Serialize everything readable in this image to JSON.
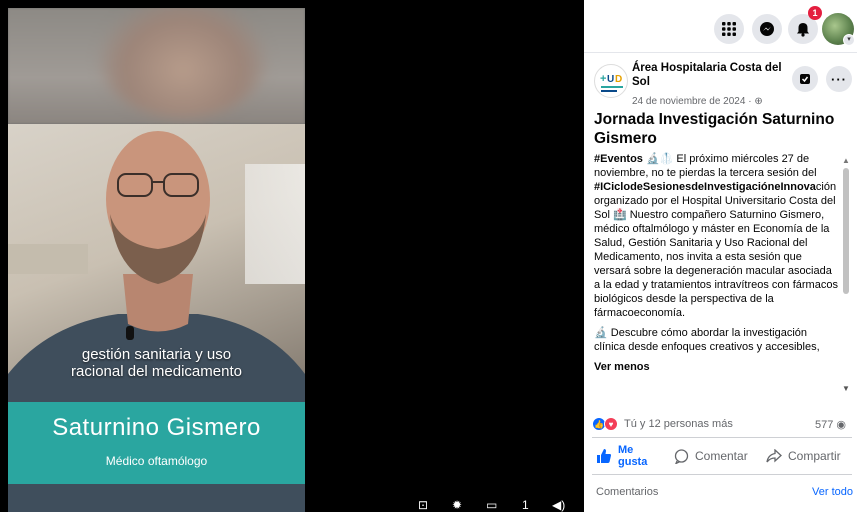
{
  "video": {
    "caption_line1": "gestión sanitaria y uso",
    "caption_line2": "racional del medicamento",
    "banner_name": "Saturnino Gismero",
    "banner_role": "Médico oftamólogo",
    "controls": {
      "duration_short": "1"
    }
  },
  "topbar": {
    "icons": [
      "menu-grid-icon",
      "messenger-icon",
      "notifications-bell-icon",
      "account-avatar"
    ],
    "notification_count": "1"
  },
  "post": {
    "page_name": "Área Hospitalaria Costa del Sol",
    "date": "24 de noviembre de 2024 · ",
    "title": "Jornada Investigación Saturnino Gismero",
    "body_p1_hashtag": "#Eventos",
    "body_p1_text": " 🔬🥼 El próximo miércoles 27 de noviembre, no te pierdas la tercera sesión del ",
    "body_p1_hashtag2": "#ICiclodeSesionesdeInvestigacióneInnova",
    "body_p1_text2": "ción organizado por el Hospital Universitario Costa del Sol 🏥 Nuestro compañero Saturnino Gismero, médico oftalmólogo y máster en Economía de la Salud, Gestión Sanitaria y Uso Racional del Medicamento, nos invita a esta sesión que versará sobre la degeneración macular asociada a la edad y tratamientos intravítreos con fármacos biológicos desde la perspectiva de la fármacoeconomía.",
    "body_p2": "🔬 Descubre cómo abordar la investigación clínica desde enfoques creativos y accesibles,",
    "see_less": "Ver menos",
    "reactions_text": "Tú y 12 personas más",
    "reactions_count": "577",
    "actions": {
      "like": "Me gusta",
      "comment": "Comentar",
      "share": "Compartir"
    },
    "comments_label": "Comentarios",
    "view_all": "Ver todo"
  },
  "colors": {
    "banner_teal": "#2aa6a0",
    "fb_blue": "#0866ff",
    "notif_red": "#e41e3f"
  }
}
